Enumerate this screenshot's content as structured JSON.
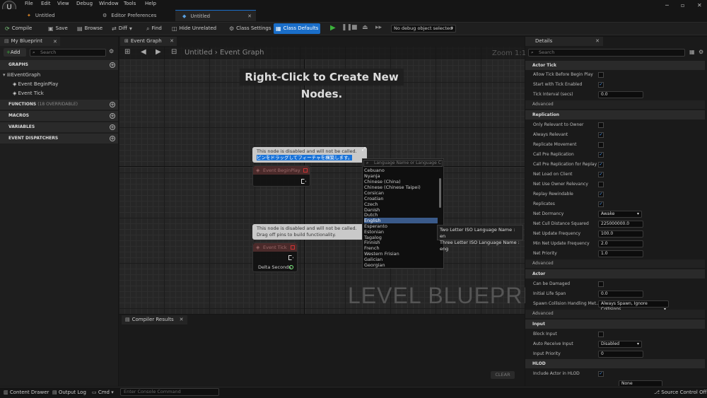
{
  "menu": [
    "File",
    "Edit",
    "View",
    "Debug",
    "Window",
    "Tools",
    "Help"
  ],
  "tabs": [
    {
      "label": "Untitled"
    },
    {
      "label": "Editor Preferences"
    },
    {
      "label": "Untitled"
    }
  ],
  "toolbar": {
    "compile": "Compile",
    "save": "Save",
    "browse": "Browse",
    "diff": "Diff",
    "find": "Find",
    "hide_unrelated": "Hide Unrelated",
    "class_settings": "Class Settings",
    "class_defaults": "Class Defaults",
    "debug_object": "No debug object selected"
  },
  "my_blueprint": {
    "tab": "My Blueprint",
    "add": "Add",
    "search_placeholder": "Search",
    "graphs_header": "GRAPHS",
    "event_graph": "EventGraph",
    "begin_play": "Event BeginPlay",
    "tick": "Event Tick",
    "functions_header": "FUNCTIONS",
    "functions_count": "(18 OVERRIDABLE)",
    "macros_header": "MACROS",
    "variables_header": "VARIABLES",
    "dispatchers_header": "EVENT DISPATCHERS"
  },
  "graph": {
    "tab": "Event Graph",
    "breadcrumb_root": "Untitled",
    "breadcrumb_sep": "›",
    "breadcrumb_leaf": "Event Graph",
    "zoom": "Zoom 1:1",
    "hint": "Right-Click to Create New Nodes.",
    "watermark": "LEVEL BLUEPRINT",
    "note_line1": "This node is disabled and will not be called.",
    "note_line2_jp": "ピンをドラッグしてフィーチャを構築します。",
    "note_line2_en": "Drag off pins to build functionality.",
    "node_begin_play": "Event BeginPlay",
    "node_tick": "Event Tick",
    "delta_seconds": "Delta Seconds"
  },
  "language_popup": {
    "placeholder": "Language Name or Language C",
    "items": [
      "Cebuano",
      "Nyanja",
      "Chinese (China)",
      "Chinese (Chinese Taipei)",
      "Corsican",
      "Croatian",
      "Czech",
      "Danish",
      "Dutch",
      "English",
      "Esperanto",
      "Estonian",
      "Tagalog",
      "Finnish",
      "French",
      "Western Frisian",
      "Galician",
      "Georgian"
    ],
    "selected": "English",
    "tooltip_line1": "Two Letter ISO Language Name : en",
    "tooltip_line2": "Three Letter ISO Language Name : eng"
  },
  "compiler": {
    "tab": "Compiler Results",
    "clear": "CLEAR"
  },
  "details": {
    "tab": "Details",
    "search_placeholder": "Search",
    "advanced": "Advanced",
    "actor_tick": {
      "header": "Actor Tick",
      "allow_before_begin_play": "Allow Tick Before Begin Play",
      "start_enabled": "Start with Tick Enabled",
      "interval_label": "Tick Interval (secs)",
      "interval_value": "0.0"
    },
    "replication": {
      "header": "Replication",
      "only_relevant_owner": "Only Relevant to Owner",
      "always_relevant": "Always Relevant",
      "replicate_movement": "Replicate Movement",
      "call_pre_rep": "Call Pre Replication",
      "call_pre_rep_replay": "Call Pre Replication for Replay",
      "net_load_client": "Net Load on Client",
      "net_use_owner_rel": "Net Use Owner Relevancy",
      "replay_rewindable": "Replay Rewindable",
      "replicates": "Replicates",
      "net_dormancy": "Net Dormancy",
      "net_dormancy_value": "Awake",
      "cull_label": "Net Cull Distance Squared",
      "cull_value": "225000000.0",
      "update_freq_label": "Net Update Frequency",
      "update_freq_value": "100.0",
      "min_update_label": "Min Net Update Frequency",
      "min_update_value": "2.0",
      "priority_label": "Net Priority",
      "priority_value": "1.0"
    },
    "actor": {
      "header": "Actor",
      "can_be_damaged": "Can be Damaged",
      "life_span_label": "Initial Life Span",
      "life_span_value": "0.0",
      "spawn_label": "Spawn Collision Handling Met...",
      "spawn_value": "Always Spawn, Ignore Collisions"
    },
    "input": {
      "header": "Input",
      "block_input": "Block Input",
      "auto_receive": "Auto Receive Input",
      "auto_receive_value": "Disabled",
      "priority_label": "Input Priority",
      "priority_value": "0"
    },
    "hlod": {
      "header": "HLOD",
      "include": "Include Actor in HLOD",
      "next_value": "None"
    }
  },
  "statusbar": {
    "content_drawer": "Content Drawer",
    "output_log": "Output Log",
    "cmd": "Cmd",
    "console_placeholder": "Enter Console Command",
    "source_control": "Source Control Off"
  }
}
